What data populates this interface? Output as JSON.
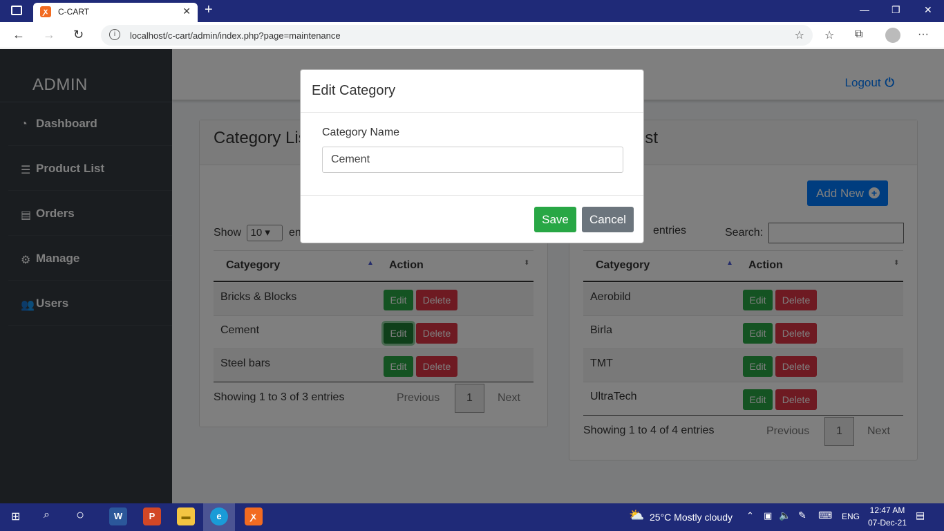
{
  "browser": {
    "tab_title": "C-CART",
    "tab_close": "✕",
    "new_tab": "+",
    "url": "localhost/c-cart/admin/index.php?page=maintenance",
    "minimize": "—",
    "restore": "❐",
    "close": "✕",
    "more": "···"
  },
  "sidebar": {
    "brand": "ADMIN",
    "items": [
      {
        "label": "Dashboard",
        "icon": "tachometer-icon"
      },
      {
        "label": "Product List",
        "icon": "list-icon"
      },
      {
        "label": "Orders",
        "icon": "document-icon"
      },
      {
        "label": "Manage",
        "icon": "gears-icon"
      },
      {
        "label": "Users",
        "icon": "users-icon"
      }
    ]
  },
  "topnav": {
    "logout": "Logout"
  },
  "category_card": {
    "title": "Category List",
    "show": "Show",
    "entries_value": "10",
    "entries": "entries",
    "col_category": "Catyegory",
    "col_action": "Action",
    "rows": [
      "Bricks & Blocks",
      "Cement",
      "Steel bars"
    ],
    "info": "Showing 1 to 3 of 3 entries",
    "previous": "Previous",
    "page": "1",
    "next": "Next"
  },
  "brand_card": {
    "title": "Brand List",
    "add_new": "Add New",
    "entries": "entries",
    "search": "Search:",
    "col_category": "Catyegory",
    "col_action": "Action",
    "rows": [
      "Aerobild",
      "Birla",
      "TMT",
      "UltraTech"
    ],
    "info": "Showing 1 to 4 of 4 entries",
    "previous": "Previous",
    "page": "1",
    "next": "Next"
  },
  "buttons": {
    "edit": "Edit",
    "delete": "Delete"
  },
  "modal": {
    "title": "Edit Category",
    "field_label": "Category Name",
    "field_value": "Cement",
    "save": "Save",
    "cancel": "Cancel"
  },
  "taskbar": {
    "weather": "25°C  Mostly cloudy",
    "lang": "ENG",
    "time": "12:47 AM",
    "date": "07-Dec-21"
  },
  "colors": {
    "primary": "#007bff",
    "success": "#28a745",
    "danger": "#dc3545",
    "secondary": "#6c757d",
    "sidebar": "#343a40",
    "titlebar": "#1f2a78"
  }
}
